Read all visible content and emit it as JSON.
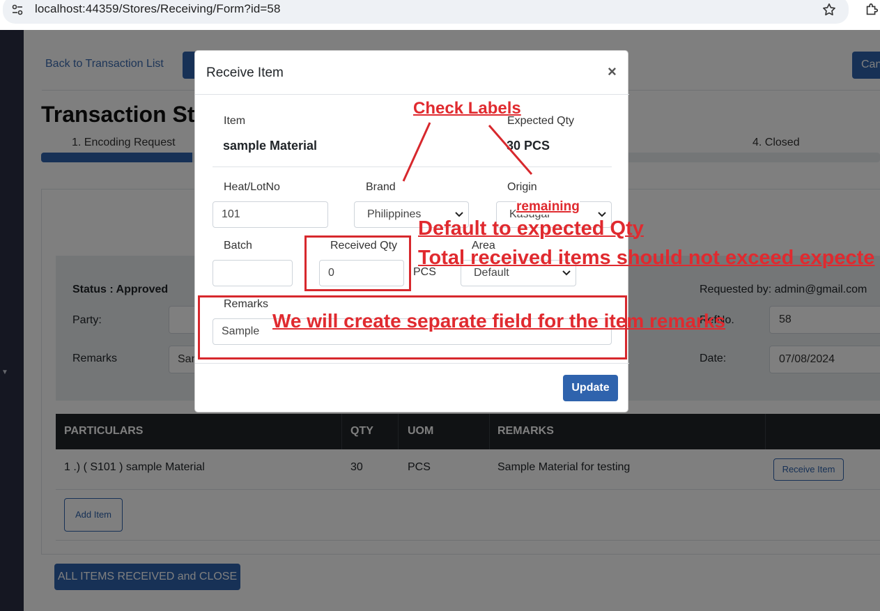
{
  "browser": {
    "url": "localhost:44359/Stores/Receiving/Form?id=58"
  },
  "page": {
    "back_link": "Back to Transaction List",
    "cancel_button": "Can",
    "title": "Transaction Sta",
    "steps": {
      "step1": "1. Encoding Request",
      "step4": "4. Closed"
    },
    "progress_fraction": 0.18,
    "status": "Status : Approved",
    "party_label": "Party:",
    "remarks_label": "Remarks",
    "remarks_value": "Sample Material for testing",
    "requested_by": "Requested by: admin@gmail.com",
    "refno_label": "RefNo.",
    "refno_value": "58",
    "date_label": "Date:",
    "date_value": "07/08/2024",
    "table": {
      "headers": [
        "PARTICULARS",
        "QTY",
        "UOM",
        "REMARKS"
      ],
      "rows": [
        {
          "particulars": "1 .) ( S101 ) sample Material",
          "qty": "30",
          "uom": "PCS",
          "remarks": "Sample Material for testing",
          "action": "Receive Item"
        }
      ],
      "add_item": "Add Item"
    },
    "close_all_button": "ALL ITEMS RECEIVED and CLOSE"
  },
  "modal": {
    "title": "Receive Item",
    "close_glyph": "×",
    "item_label": "Item",
    "item_value": "sample Material",
    "expected_qty_label": "Expected Qty",
    "expected_qty_value": "30 PCS",
    "heat_lot_label": "Heat/LotNo",
    "heat_lot_value": "101",
    "brand_label": "Brand",
    "brand_value": "Philippines",
    "origin_label": "Origin",
    "origin_value": "Kasugai",
    "batch_label": "Batch",
    "batch_value": "",
    "received_qty_label": "Received Qty",
    "received_qty_value": "0",
    "received_qty_unit": "PCS",
    "area_label": "Area",
    "area_value": "Default",
    "remarks_label": "Remarks",
    "remarks_value": "Sample",
    "update_button": "Update"
  },
  "annotations": {
    "check_labels": "Check Labels",
    "remaining": "remaining",
    "default_expected": "Default to expected Qty",
    "total_received": "Total received items should not exceed expecte",
    "separate_field": "We will create separate field for the item remarks",
    "color": "#e02a2f"
  }
}
